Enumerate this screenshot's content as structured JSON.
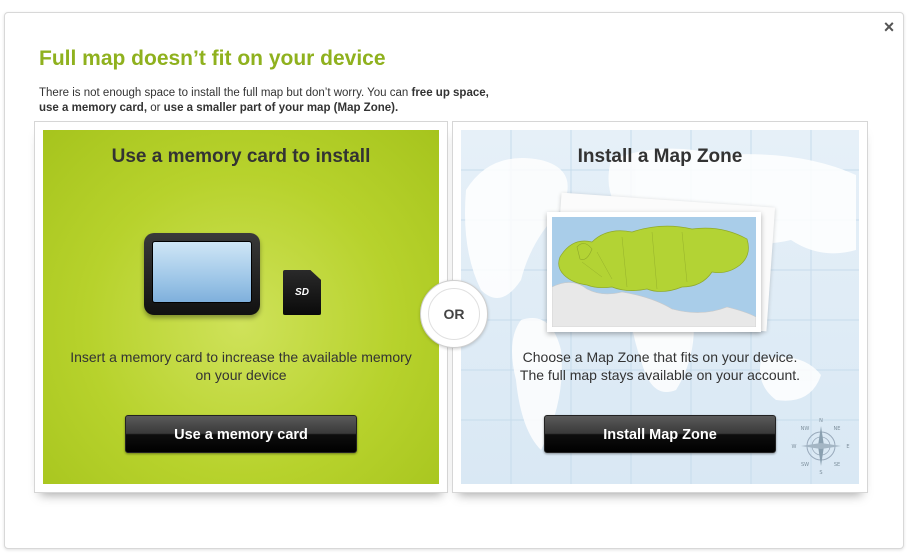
{
  "dialog": {
    "close_label": "×",
    "title": "Full map doesn’t fit on your device",
    "description": {
      "part1": "There is not enough space to install the full map but don’t worry. You can ",
      "bold1": "free up space,",
      "bold2": "use a memory card,",
      "part2": " or ",
      "bold3": "use a smaller part of your map (Map Zone)."
    }
  },
  "memory_card_option": {
    "title": "Use a memory card to install",
    "text": "Insert a memory card to increase the available memory on your device",
    "sd_label": "SD",
    "button_label": "Use a memory card"
  },
  "separator": {
    "label": "OR"
  },
  "map_zone_option": {
    "title": "Install a Map Zone",
    "text_line1": "Choose a Map Zone that fits on your device.",
    "text_line2": "The full map stays available on your account.",
    "button_label": "Install Map Zone",
    "compass": {
      "n": "N",
      "s": "S",
      "e": "E",
      "w": "W",
      "nw": "NW",
      "ne": "NE",
      "sw": "SW",
      "se": "SE"
    }
  },
  "colors": {
    "title_green": "#8fb11e",
    "panel_green": "#b7d22c",
    "map_water": "#dae9f5",
    "map_zone_highlight": "#b3d334",
    "button_black": "#000000"
  }
}
